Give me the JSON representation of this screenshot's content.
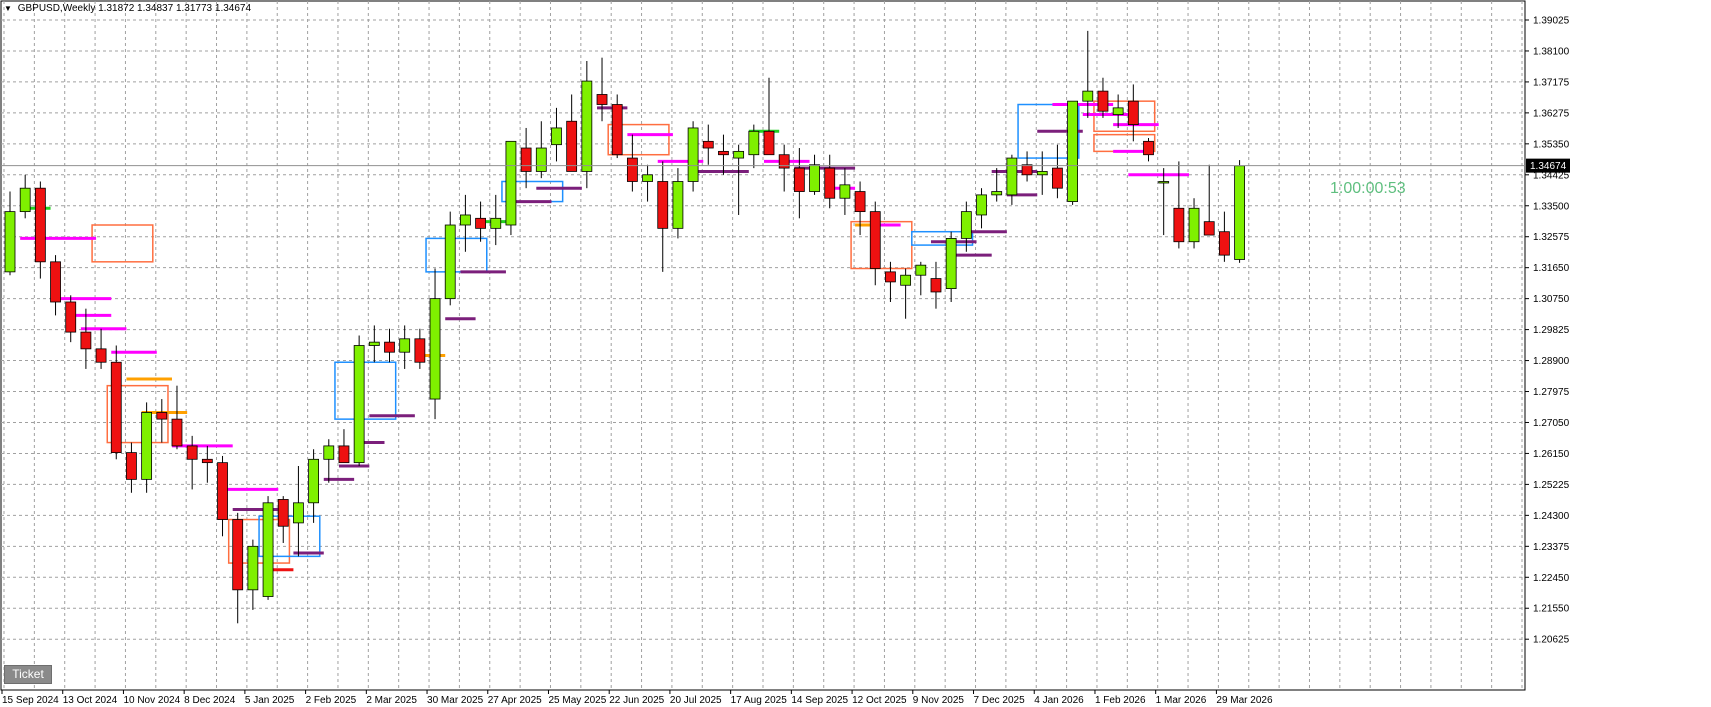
{
  "header": {
    "symbol": "GBPUSD,Weekly",
    "ohlc": "1.31872 1.34837 1.31773 1.34674"
  },
  "ticket_label": "Ticket",
  "countdown": "1:00:00:53",
  "current_price_label": "1.34674",
  "colors": {
    "bull": "#7ff000",
    "bear": "#ee1111",
    "grid": "#a0a0a0",
    "price_line": "#909090",
    "price_box": "#000000",
    "zone_blue": "#1e90ff",
    "zone_orange": "#ff6e40",
    "purple": "#7b1f7b",
    "magenta": "#ff00ff",
    "orange": "#ffa000",
    "red": "#ee1111",
    "green": "#22d022"
  },
  "chart_data": {
    "type": "candlestick",
    "symbol": "GBPUSD",
    "timeframe": "Weekly",
    "ylim": [
      1.2062,
      1.3945
    ],
    "y_ticks": [
      "1.39025",
      "1.38100",
      "1.37175",
      "1.36275",
      "1.35350",
      "1.34425",
      "1.33500",
      "1.32575",
      "1.31650",
      "1.30750",
      "1.29825",
      "1.28900",
      "1.27975",
      "1.27050",
      "1.26150",
      "1.25225",
      "1.24300",
      "1.23375",
      "1.22450",
      "1.21550",
      "1.20625"
    ],
    "x_ticks": [
      {
        "label": "15 Sep 2024",
        "index": 0
      },
      {
        "label": "13 Oct 2024",
        "index": 4
      },
      {
        "label": "10 Nov 2024",
        "index": 8
      },
      {
        "label": "8 Dec 2024",
        "index": 12
      },
      {
        "label": "5 Jan 2025",
        "index": 16
      },
      {
        "label": "2 Feb 2025",
        "index": 20
      },
      {
        "label": "2 Mar 2025",
        "index": 24
      },
      {
        "label": "30 Mar 2025",
        "index": 28
      },
      {
        "label": "27 Apr 2025",
        "index": 32
      },
      {
        "label": "25 May 2025",
        "index": 36
      },
      {
        "label": "22 Jun 2025",
        "index": 40
      },
      {
        "label": "20 Jul 2025",
        "index": 44
      },
      {
        "label": "17 Aug 2025",
        "index": 48
      },
      {
        "label": "14 Sep 2025",
        "index": 52
      },
      {
        "label": "12 Oct 2025",
        "index": 56
      },
      {
        "label": "9 Nov 2025",
        "index": 60
      },
      {
        "label": "7 Dec 2025",
        "index": 64
      },
      {
        "label": "4 Jan 2026",
        "index": 68
      },
      {
        "label": "1 Feb 2026",
        "index": 72
      },
      {
        "label": "1 Mar 2026",
        "index": 76
      },
      {
        "label": "29 Mar 2026",
        "index": 80
      }
    ],
    "current_price": 1.34674,
    "candles": [
      {
        "o": 1.315,
        "h": 1.339,
        "l": 1.314,
        "c": 1.333
      },
      {
        "o": 1.333,
        "h": 1.344,
        "l": 1.331,
        "c": 1.34
      },
      {
        "o": 1.34,
        "h": 1.342,
        "l": 1.313,
        "c": 1.318
      },
      {
        "o": 1.318,
        "h": 1.32,
        "l": 1.302,
        "c": 1.306
      },
      {
        "o": 1.306,
        "h": 1.308,
        "l": 1.294,
        "c": 1.297
      },
      {
        "o": 1.297,
        "h": 1.304,
        "l": 1.286,
        "c": 1.292
      },
      {
        "o": 1.292,
        "h": 1.298,
        "l": 1.286,
        "c": 1.288
      },
      {
        "o": 1.288,
        "h": 1.293,
        "l": 1.259,
        "c": 1.261
      },
      {
        "o": 1.261,
        "h": 1.264,
        "l": 1.249,
        "c": 1.253
      },
      {
        "o": 1.253,
        "h": 1.276,
        "l": 1.249,
        "c": 1.273
      },
      {
        "o": 1.273,
        "h": 1.277,
        "l": 1.264,
        "c": 1.271
      },
      {
        "o": 1.271,
        "h": 1.281,
        "l": 1.262,
        "c": 1.263
      },
      {
        "o": 1.263,
        "h": 1.266,
        "l": 1.25,
        "c": 1.259
      },
      {
        "o": 1.259,
        "h": 1.263,
        "l": 1.252,
        "c": 1.258
      },
      {
        "o": 1.258,
        "h": 1.26,
        "l": 1.236,
        "c": 1.241
      },
      {
        "o": 1.241,
        "h": 1.243,
        "l": 1.21,
        "c": 1.22
      },
      {
        "o": 1.22,
        "h": 1.235,
        "l": 1.214,
        "c": 1.233
      },
      {
        "o": 1.218,
        "h": 1.248,
        "l": 1.217,
        "c": 1.246
      },
      {
        "o": 1.247,
        "h": 1.248,
        "l": 1.234,
        "c": 1.239
      },
      {
        "o": 1.24,
        "h": 1.257,
        "l": 1.23,
        "c": 1.246
      },
      {
        "o": 1.246,
        "h": 1.262,
        "l": 1.24,
        "c": 1.259
      },
      {
        "o": 1.259,
        "h": 1.265,
        "l": 1.252,
        "c": 1.263
      },
      {
        "o": 1.263,
        "h": 1.268,
        "l": 1.258,
        "c": 1.258
      },
      {
        "o": 1.258,
        "h": 1.296,
        "l": 1.257,
        "c": 1.293
      },
      {
        "o": 1.293,
        "h": 1.299,
        "l": 1.288,
        "c": 1.294
      },
      {
        "o": 1.294,
        "h": 1.298,
        "l": 1.288,
        "c": 1.291
      },
      {
        "o": 1.291,
        "h": 1.299,
        "l": 1.286,
        "c": 1.295
      },
      {
        "o": 1.295,
        "h": 1.298,
        "l": 1.286,
        "c": 1.288
      },
      {
        "o": 1.277,
        "h": 1.316,
        "l": 1.271,
        "c": 1.307
      },
      {
        "o": 1.307,
        "h": 1.333,
        "l": 1.305,
        "c": 1.329
      },
      {
        "o": 1.329,
        "h": 1.338,
        "l": 1.321,
        "c": 1.332
      },
      {
        "o": 1.331,
        "h": 1.336,
        "l": 1.324,
        "c": 1.328
      },
      {
        "o": 1.328,
        "h": 1.338,
        "l": 1.323,
        "c": 1.331
      },
      {
        "o": 1.329,
        "h": 1.34,
        "l": 1.326,
        "c": 1.354
      },
      {
        "o": 1.352,
        "h": 1.358,
        "l": 1.34,
        "c": 1.345
      },
      {
        "o": 1.345,
        "h": 1.36,
        "l": 1.343,
        "c": 1.352
      },
      {
        "o": 1.353,
        "h": 1.364,
        "l": 1.348,
        "c": 1.358
      },
      {
        "o": 1.36,
        "h": 1.368,
        "l": 1.352,
        "c": 1.345
      },
      {
        "o": 1.345,
        "h": 1.378,
        "l": 1.34,
        "c": 1.372
      },
      {
        "o": 1.368,
        "h": 1.379,
        "l": 1.36,
        "c": 1.365
      },
      {
        "o": 1.365,
        "h": 1.368,
        "l": 1.349,
        "c": 1.35
      },
      {
        "o": 1.349,
        "h": 1.356,
        "l": 1.339,
        "c": 1.342
      },
      {
        "o": 1.342,
        "h": 1.347,
        "l": 1.336,
        "c": 1.344
      },
      {
        "o": 1.342,
        "h": 1.348,
        "l": 1.315,
        "c": 1.328
      },
      {
        "o": 1.328,
        "h": 1.346,
        "l": 1.325,
        "c": 1.342
      },
      {
        "o": 1.342,
        "h": 1.36,
        "l": 1.339,
        "c": 1.358
      },
      {
        "o": 1.354,
        "h": 1.359,
        "l": 1.347,
        "c": 1.352
      },
      {
        "o": 1.351,
        "h": 1.356,
        "l": 1.344,
        "c": 1.35
      },
      {
        "o": 1.349,
        "h": 1.353,
        "l": 1.332,
        "c": 1.351
      },
      {
        "o": 1.35,
        "h": 1.359,
        "l": 1.346,
        "c": 1.357
      },
      {
        "o": 1.357,
        "h": 1.373,
        "l": 1.35,
        "c": 1.35
      },
      {
        "o": 1.35,
        "h": 1.353,
        "l": 1.339,
        "c": 1.346
      },
      {
        "o": 1.346,
        "h": 1.352,
        "l": 1.331,
        "c": 1.339
      },
      {
        "o": 1.339,
        "h": 1.35,
        "l": 1.338,
        "c": 1.347
      },
      {
        "o": 1.346,
        "h": 1.35,
        "l": 1.334,
        "c": 1.337
      },
      {
        "o": 1.337,
        "h": 1.346,
        "l": 1.332,
        "c": 1.341
      },
      {
        "o": 1.339,
        "h": 1.342,
        "l": 1.326,
        "c": 1.333
      },
      {
        "o": 1.333,
        "h": 1.336,
        "l": 1.311,
        "c": 1.316
      },
      {
        "o": 1.315,
        "h": 1.318,
        "l": 1.306,
        "c": 1.312
      },
      {
        "o": 1.311,
        "h": 1.316,
        "l": 1.301,
        "c": 1.314
      },
      {
        "o": 1.314,
        "h": 1.318,
        "l": 1.308,
        "c": 1.317
      },
      {
        "o": 1.313,
        "h": 1.318,
        "l": 1.304,
        "c": 1.309
      },
      {
        "o": 1.31,
        "h": 1.327,
        "l": 1.306,
        "c": 1.325
      },
      {
        "o": 1.325,
        "h": 1.336,
        "l": 1.321,
        "c": 1.333
      },
      {
        "o": 1.332,
        "h": 1.34,
        "l": 1.328,
        "c": 1.338
      },
      {
        "o": 1.338,
        "h": 1.346,
        "l": 1.336,
        "c": 1.339
      },
      {
        "o": 1.338,
        "h": 1.35,
        "l": 1.335,
        "c": 1.349
      },
      {
        "o": 1.347,
        "h": 1.351,
        "l": 1.342,
        "c": 1.344
      },
      {
        "o": 1.344,
        "h": 1.351,
        "l": 1.338,
        "c": 1.345
      },
      {
        "o": 1.346,
        "h": 1.353,
        "l": 1.337,
        "c": 1.34
      },
      {
        "o": 1.336,
        "h": 1.366,
        "l": 1.335,
        "c": 1.366
      },
      {
        "o": 1.366,
        "h": 1.387,
        "l": 1.361,
        "c": 1.369
      },
      {
        "o": 1.369,
        "h": 1.373,
        "l": 1.361,
        "c": 1.363
      },
      {
        "o": 1.362,
        "h": 1.368,
        "l": 1.358,
        "c": 1.364
      },
      {
        "o": 1.366,
        "h": 1.371,
        "l": 1.354,
        "c": 1.359
      },
      {
        "o": 1.354,
        "h": 1.355,
        "l": 1.348,
        "c": 1.35
      },
      {
        "o": 1.342,
        "h": 1.346,
        "l": 1.326,
        "c": 1.342
      },
      {
        "o": 1.334,
        "h": 1.348,
        "l": 1.322,
        "c": 1.324
      },
      {
        "o": 1.324,
        "h": 1.337,
        "l": 1.322,
        "c": 1.334
      },
      {
        "o": 1.33,
        "h": 1.347,
        "l": 1.326,
        "c": 1.326
      },
      {
        "o": 1.327,
        "h": 1.333,
        "l": 1.318,
        "c": 1.32
      },
      {
        "o": 1.3187,
        "h": 1.3484,
        "l": 1.3177,
        "c": 1.3467
      }
    ]
  }
}
